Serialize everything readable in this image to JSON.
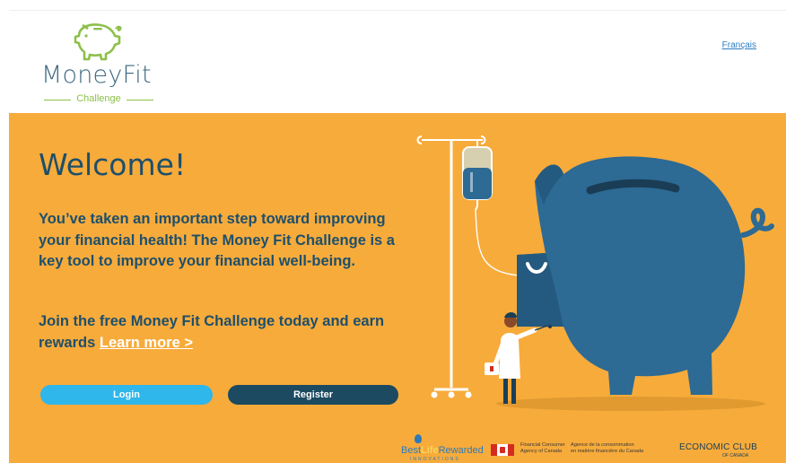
{
  "header": {
    "logo_title": "MoneyFit",
    "logo_subtitle": "Challenge",
    "language_link": "Français"
  },
  "hero": {
    "heading": "Welcome!",
    "intro": "You’ve taken an important step toward improving your financial health! The Money Fit Challenge is a key tool to improve your financial well-being.",
    "join_text": "Join the free Money Fit Challenge today and earn rewards",
    "learn_more": "Learn more >",
    "login_button": "Login",
    "register_button": "Register"
  },
  "partners": {
    "bestlife_a": "Best",
    "bestlife_b": "Life",
    "bestlife_c": "Rewarded",
    "bestlife_tagline": "INNOVATIONS",
    "fcac_en": "Financial Consumer\nAgency of Canada",
    "fcac_fr": "Agence de la consommation\nen matière financière du Canada",
    "economic_club": "ECONOMIC CLUB",
    "economic_club_sub": "OF CANADA"
  },
  "colors": {
    "hero_background": "#f7ab3b",
    "heading_text": "#1e4f6b",
    "login_button": "#2fb6ea",
    "register_button": "#1c4a60",
    "pig": "#2d6a94",
    "logo_green": "#8cc04a"
  },
  "icons": {
    "logo_icon": "piggy-bank-outline-icon",
    "flag": "canada-flag-icon"
  }
}
